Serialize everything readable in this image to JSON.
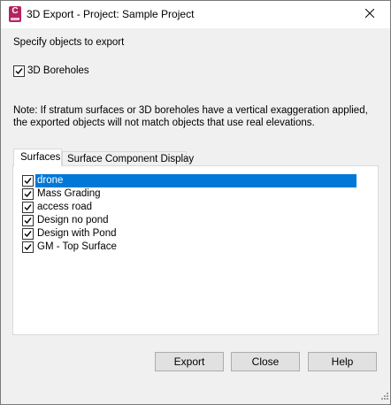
{
  "window": {
    "title": "3D Export - Project: Sample Project",
    "app_icon_letter": "C",
    "close_glyph": "×"
  },
  "instructions": "Specify objects to export",
  "boreholes": {
    "label": "3D Boreholes",
    "checked": true
  },
  "note": "Note: If stratum surfaces or 3D boreholes have a vertical exaggeration applied, the exported objects will not match objects that use real elevations.",
  "tabs": [
    {
      "label": "Surfaces",
      "active": true
    },
    {
      "label": "Surface Component Display",
      "active": false
    }
  ],
  "surfaces": [
    {
      "name": "drone",
      "checked": true,
      "selected": true
    },
    {
      "name": "Mass Grading",
      "checked": true,
      "selected": false
    },
    {
      "name": "access road",
      "checked": true,
      "selected": false
    },
    {
      "name": "Design no pond",
      "checked": true,
      "selected": false
    },
    {
      "name": "Design with Pond",
      "checked": true,
      "selected": false
    },
    {
      "name": "GM - Top Surface",
      "checked": true,
      "selected": false
    }
  ],
  "buttons": {
    "export": "Export",
    "close": "Close",
    "help": "Help"
  },
  "colors": {
    "selection": "#0078d7",
    "app_icon": "#b3245e"
  }
}
